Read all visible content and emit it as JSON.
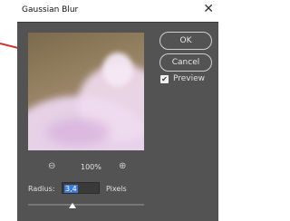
{
  "window": {
    "title": "Gaussian Blur",
    "close_glyph": "✕"
  },
  "buttons": {
    "ok": "OK",
    "cancel": "Cancel"
  },
  "preview": {
    "label": "Preview",
    "checked": true,
    "check_glyph": "✔"
  },
  "zoom": {
    "out_glyph": "⊖",
    "percent": "100%",
    "in_glyph": "⊕"
  },
  "radius": {
    "label": "Radius:",
    "value": "3,4",
    "units": "Pixels"
  },
  "slider": {
    "value_fraction": 0.38
  },
  "annotation": {
    "color": "#d0302a",
    "icon": "red-arrow"
  }
}
